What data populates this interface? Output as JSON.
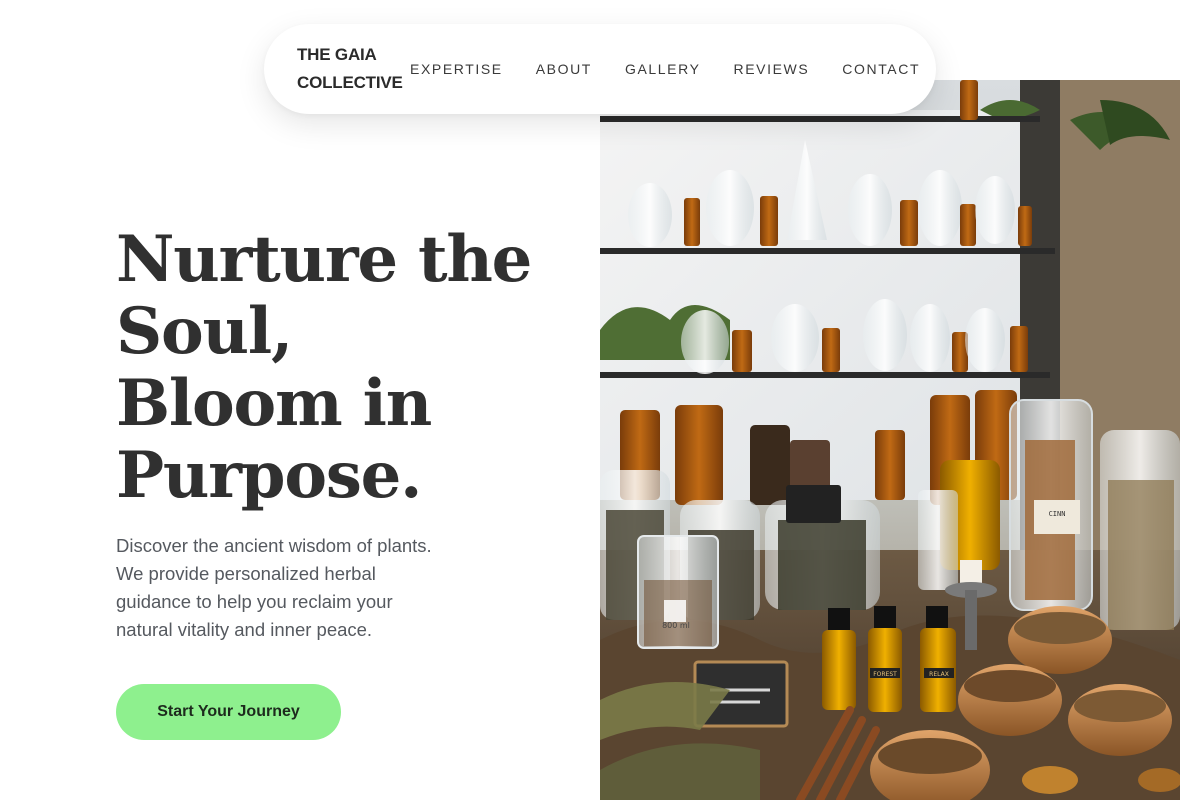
{
  "brand": {
    "line1": "THE GAIA",
    "line2": "COLLECTIVE"
  },
  "nav": {
    "links": [
      {
        "label": "EXPERTISE"
      },
      {
        "label": "ABOUT"
      },
      {
        "label": "GALLERY"
      },
      {
        "label": "REVIEWS"
      },
      {
        "label": "CONTACT"
      }
    ]
  },
  "hero": {
    "headline_lines": [
      "Nurture the",
      "Soul,",
      "Bloom in",
      "Purpose."
    ],
    "subtext_lines": [
      "Discover the ancient wisdom of plants.",
      "We provide personalized herbal",
      "guidance to help you reclaim your",
      "natural vitality and inner peace."
    ],
    "cta_label": "Start Your Journey",
    "image": {
      "subject": "apothecary-shelves-with-herb-jars",
      "jar_labels": [
        "800 ml",
        "FOREST",
        "RELAX"
      ]
    }
  },
  "colors": {
    "text_dark": "#303030",
    "text_muted": "#55595f",
    "accent_green": "#8ef08e",
    "nav_bg": "#ffffff"
  }
}
